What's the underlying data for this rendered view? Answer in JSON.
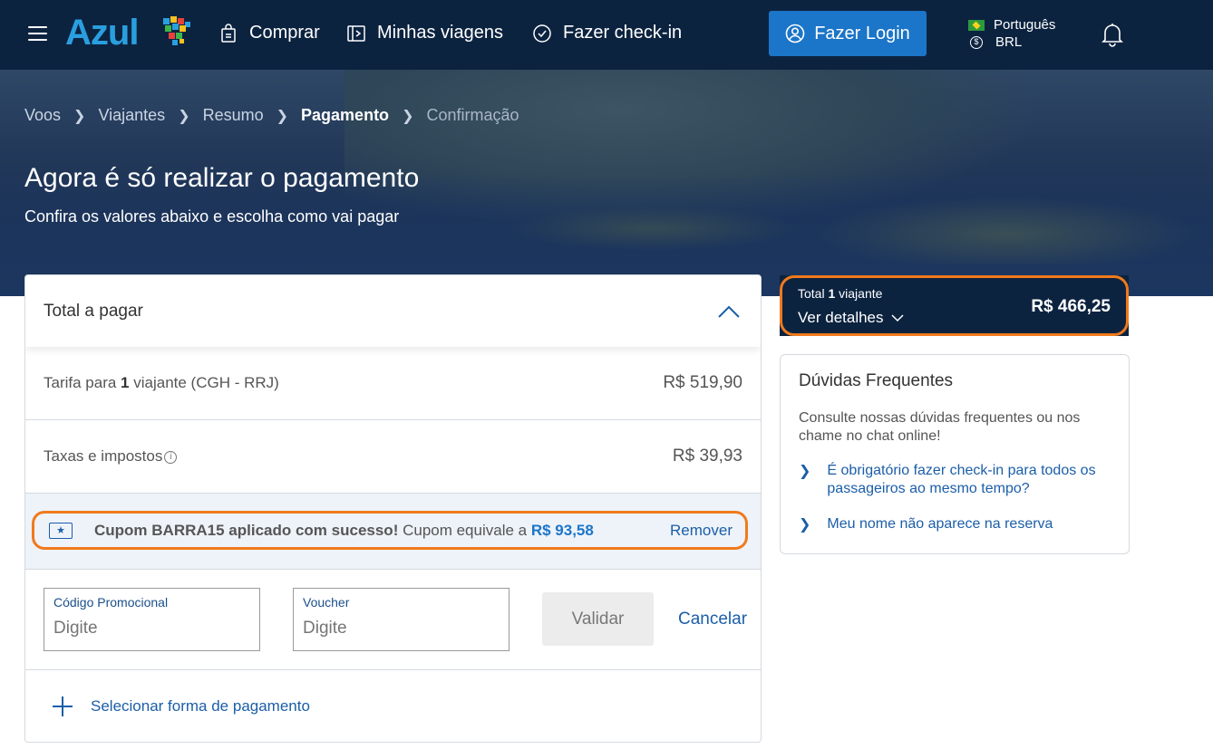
{
  "header": {
    "logo": "Azul",
    "nav": [
      {
        "label": "Comprar",
        "icon": "shopping-bag-icon"
      },
      {
        "label": "Minhas viagens",
        "icon": "ticket-icon"
      },
      {
        "label": "Fazer check-in",
        "icon": "check-circle-icon"
      }
    ],
    "login_label": "Fazer Login",
    "language": "Português",
    "currency": "BRL",
    "currency_symbol": "$"
  },
  "breadcrumb": [
    {
      "label": "Voos",
      "state": "done"
    },
    {
      "label": "Viajantes",
      "state": "done"
    },
    {
      "label": "Resumo",
      "state": "done"
    },
    {
      "label": "Pagamento",
      "state": "active"
    },
    {
      "label": "Confirmação",
      "state": "future"
    }
  ],
  "hero": {
    "title": "Agora é só realizar o pagamento",
    "subtitle": "Confira os valores abaixo e escolha como vai pagar"
  },
  "payment": {
    "title": "Total a pagar",
    "fare": {
      "prefix": "Tarifa para ",
      "count": "1",
      "suffix": " viajante (CGH - RRJ)",
      "amount": "R$ 519,90"
    },
    "taxes": {
      "label": "Taxas e impostos",
      "info": "i",
      "amount": "R$ 39,93"
    },
    "coupon": {
      "success": "Cupom BARRA15 aplicado com sucesso!",
      "equivalent": " Cupom equivale a ",
      "value": "R$ 93,58",
      "remove_label": "Remover"
    },
    "promo_field": {
      "label": "Código Promocional",
      "placeholder": "Digite"
    },
    "voucher_field": {
      "label": "Voucher",
      "placeholder": "Digite"
    },
    "validate_label": "Validar",
    "cancel_label": "Cancelar",
    "select_method_label": "Selecionar forma de pagamento"
  },
  "summary": {
    "total_prefix": "Total ",
    "total_count": "1",
    "total_suffix": " viajante",
    "details_label": "Ver detalhes",
    "total_price": "R$ 466,25"
  },
  "faq": {
    "title": "Dúvidas Frequentes",
    "description": "Consulte nossas dúvidas frequentes ou nos chame no chat online!",
    "items": [
      "É obrigatório fazer check-in para todos os passageiros ao mesmo tempo?",
      "Meu nome não aparece na reserva"
    ]
  },
  "colors": {
    "navy": "#0c2340",
    "brand_blue": "#2a9fe0",
    "button_blue": "#1b75c8",
    "highlight_orange": "#f07a1c"
  }
}
